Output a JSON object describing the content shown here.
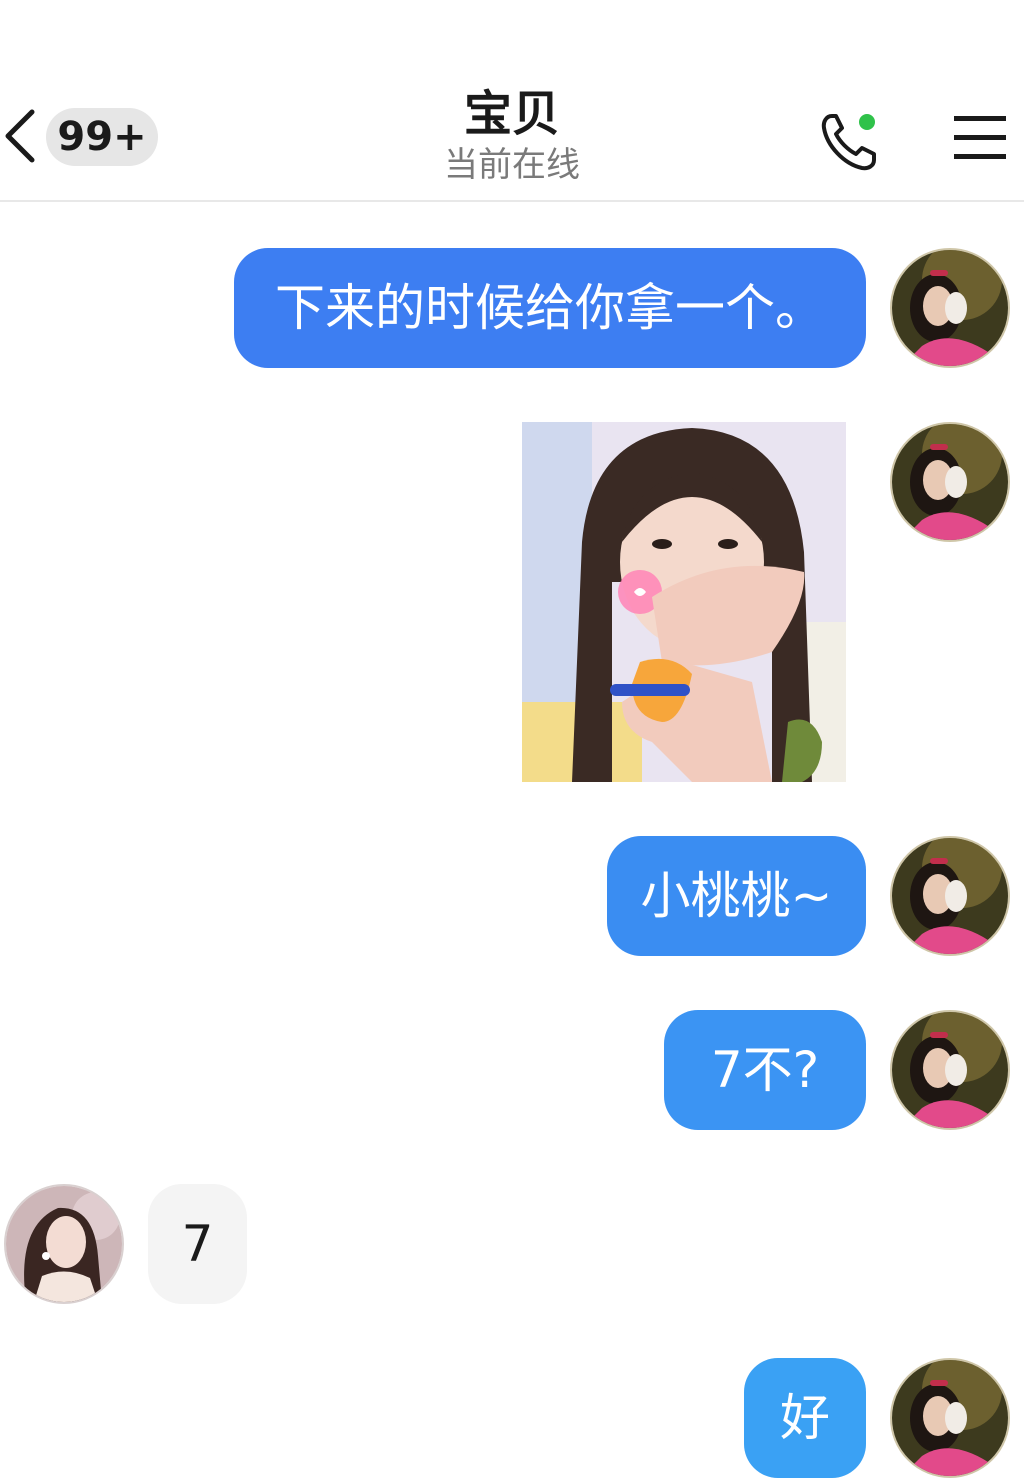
{
  "header": {
    "unread_badge": "99+",
    "contact_name": "宝贝",
    "status": "当前在线",
    "online_dot_color": "#2fc24a"
  },
  "icons": {
    "back": "chevron-left-icon",
    "call": "phone-icon",
    "menu": "hamburger-menu-icon"
  },
  "colors": {
    "outgoing_bubble_1": "#3d7ef2",
    "outgoing_bubble_2": "#3a8df2",
    "outgoing_bubble_3": "#3b94f3",
    "outgoing_bubble_4": "#3aa1f4",
    "incoming_bubble": "#f4f4f4"
  },
  "messages": [
    {
      "direction": "outgoing",
      "type": "text",
      "text": "下来的时候给你拿一个。"
    },
    {
      "direction": "outgoing",
      "type": "image",
      "image": "sticker-photo"
    },
    {
      "direction": "outgoing",
      "type": "text",
      "text": "小桃桃~"
    },
    {
      "direction": "outgoing",
      "type": "text",
      "text": "7不?"
    },
    {
      "direction": "incoming",
      "type": "text",
      "text": "7"
    },
    {
      "direction": "outgoing",
      "type": "text",
      "text": "好"
    }
  ]
}
